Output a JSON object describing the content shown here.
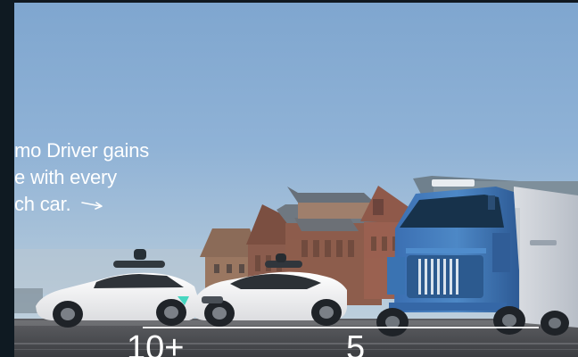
{
  "hero": {
    "headline_lines": [
      "mo Driver gains",
      "e with every",
      "ch car."
    ],
    "arrow_icon": "arrow-right-icon"
  },
  "stats": {
    "first_value": "10+",
    "second_value": "5"
  },
  "colors": {
    "text": "#ffffff",
    "sky": "#8fb2d6",
    "truck": "#3f79b6",
    "car": "#f4f4f4"
  }
}
